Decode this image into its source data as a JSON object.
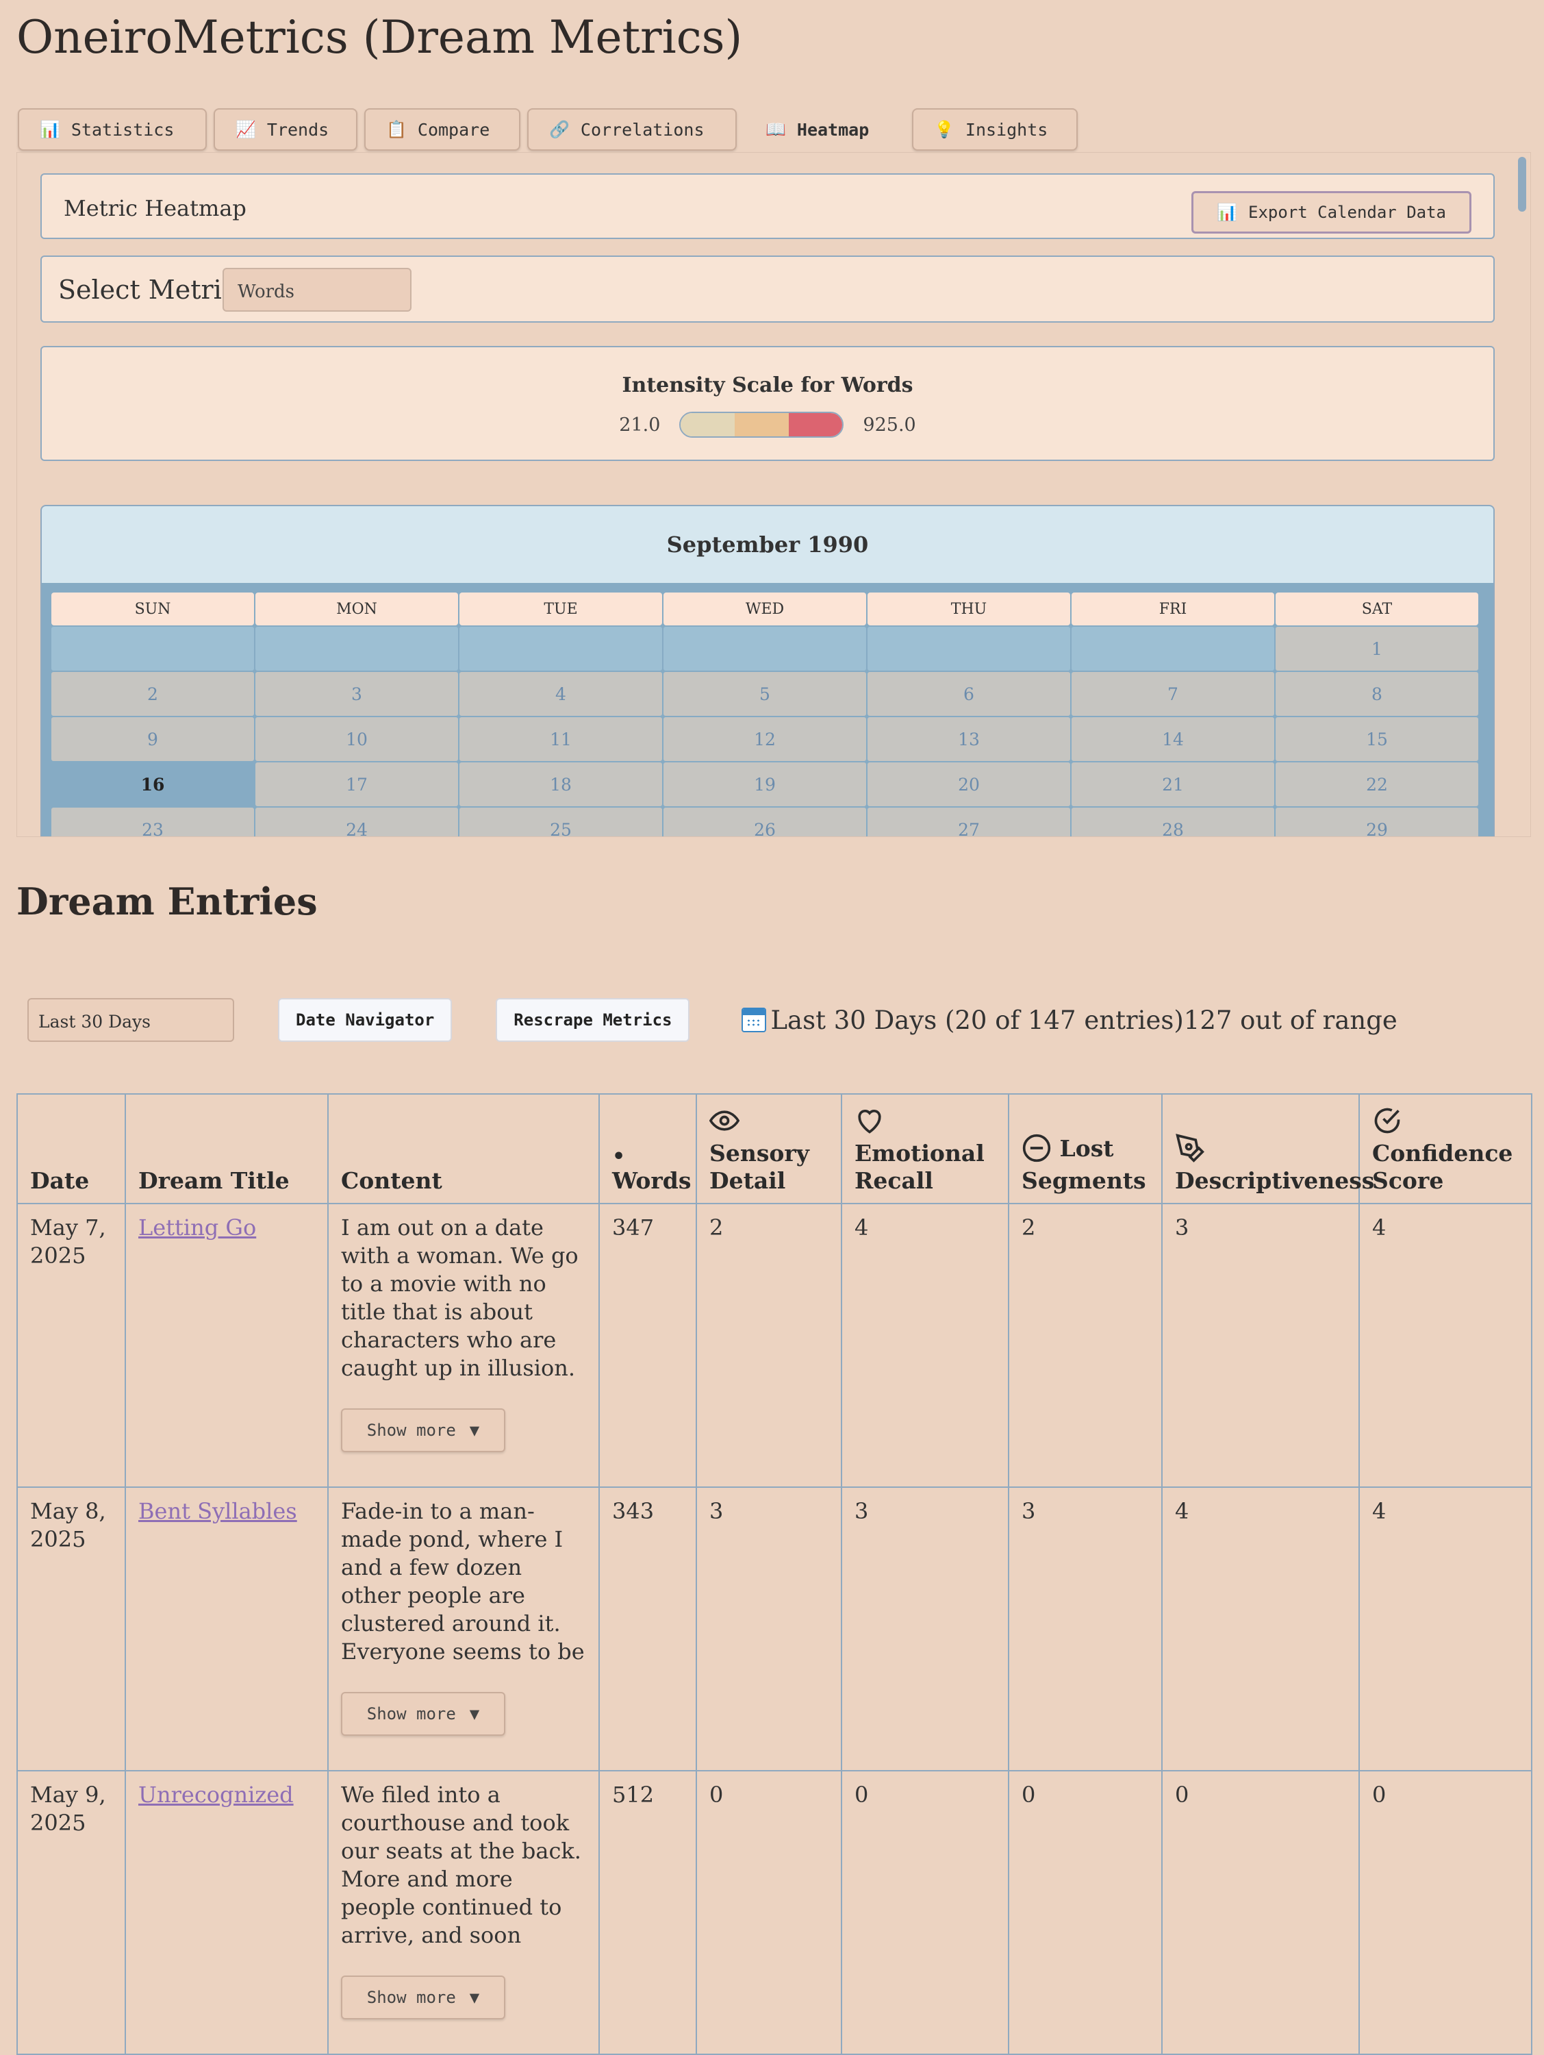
{
  "app": {
    "title": "OneiroMetrics (Dream Metrics)"
  },
  "tabs": [
    {
      "label": "Statistics",
      "icon": "bar-chart-icon",
      "glyph": "📊"
    },
    {
      "label": "Trends",
      "icon": "trend-chart-icon",
      "glyph": "📈"
    },
    {
      "label": "Compare",
      "icon": "clipboard-icon",
      "glyph": "📋"
    },
    {
      "label": "Correlations",
      "icon": "link-icon",
      "glyph": "🔗"
    },
    {
      "label": "Heatmap",
      "icon": "book-icon",
      "glyph": "📖",
      "active": true
    },
    {
      "label": "Insights",
      "icon": "lightbulb-icon",
      "glyph": "💡"
    }
  ],
  "heatmap": {
    "title": "Metric Heatmap",
    "export_label": "Export Calendar Data",
    "select_label": "Select Metric:",
    "selected_metric": "Words",
    "scale": {
      "title": "Intensity Scale for Words",
      "min": "21.0",
      "max": "925.0",
      "colors": [
        "#e3d7b8",
        "#ebc393",
        "#dc6470"
      ]
    },
    "calendar": {
      "month": "September 1990",
      "weekdays": [
        "SUN",
        "MON",
        "TUE",
        "WED",
        "THU",
        "FRI",
        "SAT"
      ],
      "leading_blanks": 6,
      "days": [
        "1",
        "2",
        "3",
        "4",
        "5",
        "6",
        "7",
        "8",
        "9",
        "10",
        "11",
        "12",
        "13",
        "14",
        "15",
        "16",
        "17",
        "18",
        "19",
        "20",
        "21",
        "22",
        "23",
        "24",
        "25",
        "26",
        "27",
        "28",
        "29"
      ],
      "today": "16"
    }
  },
  "entries": {
    "title": "Dream Entries",
    "range_value": "Last 30 Days",
    "date_navigator_label": "Date Navigator",
    "rescrape_label": "Rescrape Metrics",
    "range_info": "Last 30 Days (20 of 147 entries)127 out of range",
    "headers": {
      "date": "Date",
      "title": "Dream Title",
      "content": "Content",
      "words": "Words",
      "sensory": "Sensory Detail",
      "emotional": "Emotional Recall",
      "lost": "Lost Segments",
      "descriptiveness": "Descriptiveness",
      "confidence": "Confidence Score"
    },
    "show_more_label": "Show more",
    "rows": [
      {
        "date": "May 7, 2025",
        "title": "Letting Go",
        "content": "I am out on a date with a woman. We go to a movie with no title that is about characters who are caught up in illusion. Two women (in the",
        "words": "347",
        "sensory": "2",
        "emotional": "4",
        "lost": "2",
        "descriptiveness": "3",
        "confidence": "4"
      },
      {
        "date": "May 8, 2025",
        "title": "Bent Syllables",
        "content": "Fade-in to a man-made pond, where I and a few dozen other people are clustered around it. Everyone seems to be in happy. I call out to my",
        "words": "343",
        "sensory": "3",
        "emotional": "3",
        "lost": "3",
        "descriptiveness": "4",
        "confidence": "4"
      },
      {
        "date": "May 9, 2025",
        "title": "Unrecognized",
        "content": "We filed into a courthouse and took our seats at the back. More and more people continued to arrive, and soon every seat was full.",
        "words": "512",
        "sensory": "0",
        "emotional": "0",
        "lost": "0",
        "descriptiveness": "0",
        "confidence": "0"
      }
    ]
  }
}
